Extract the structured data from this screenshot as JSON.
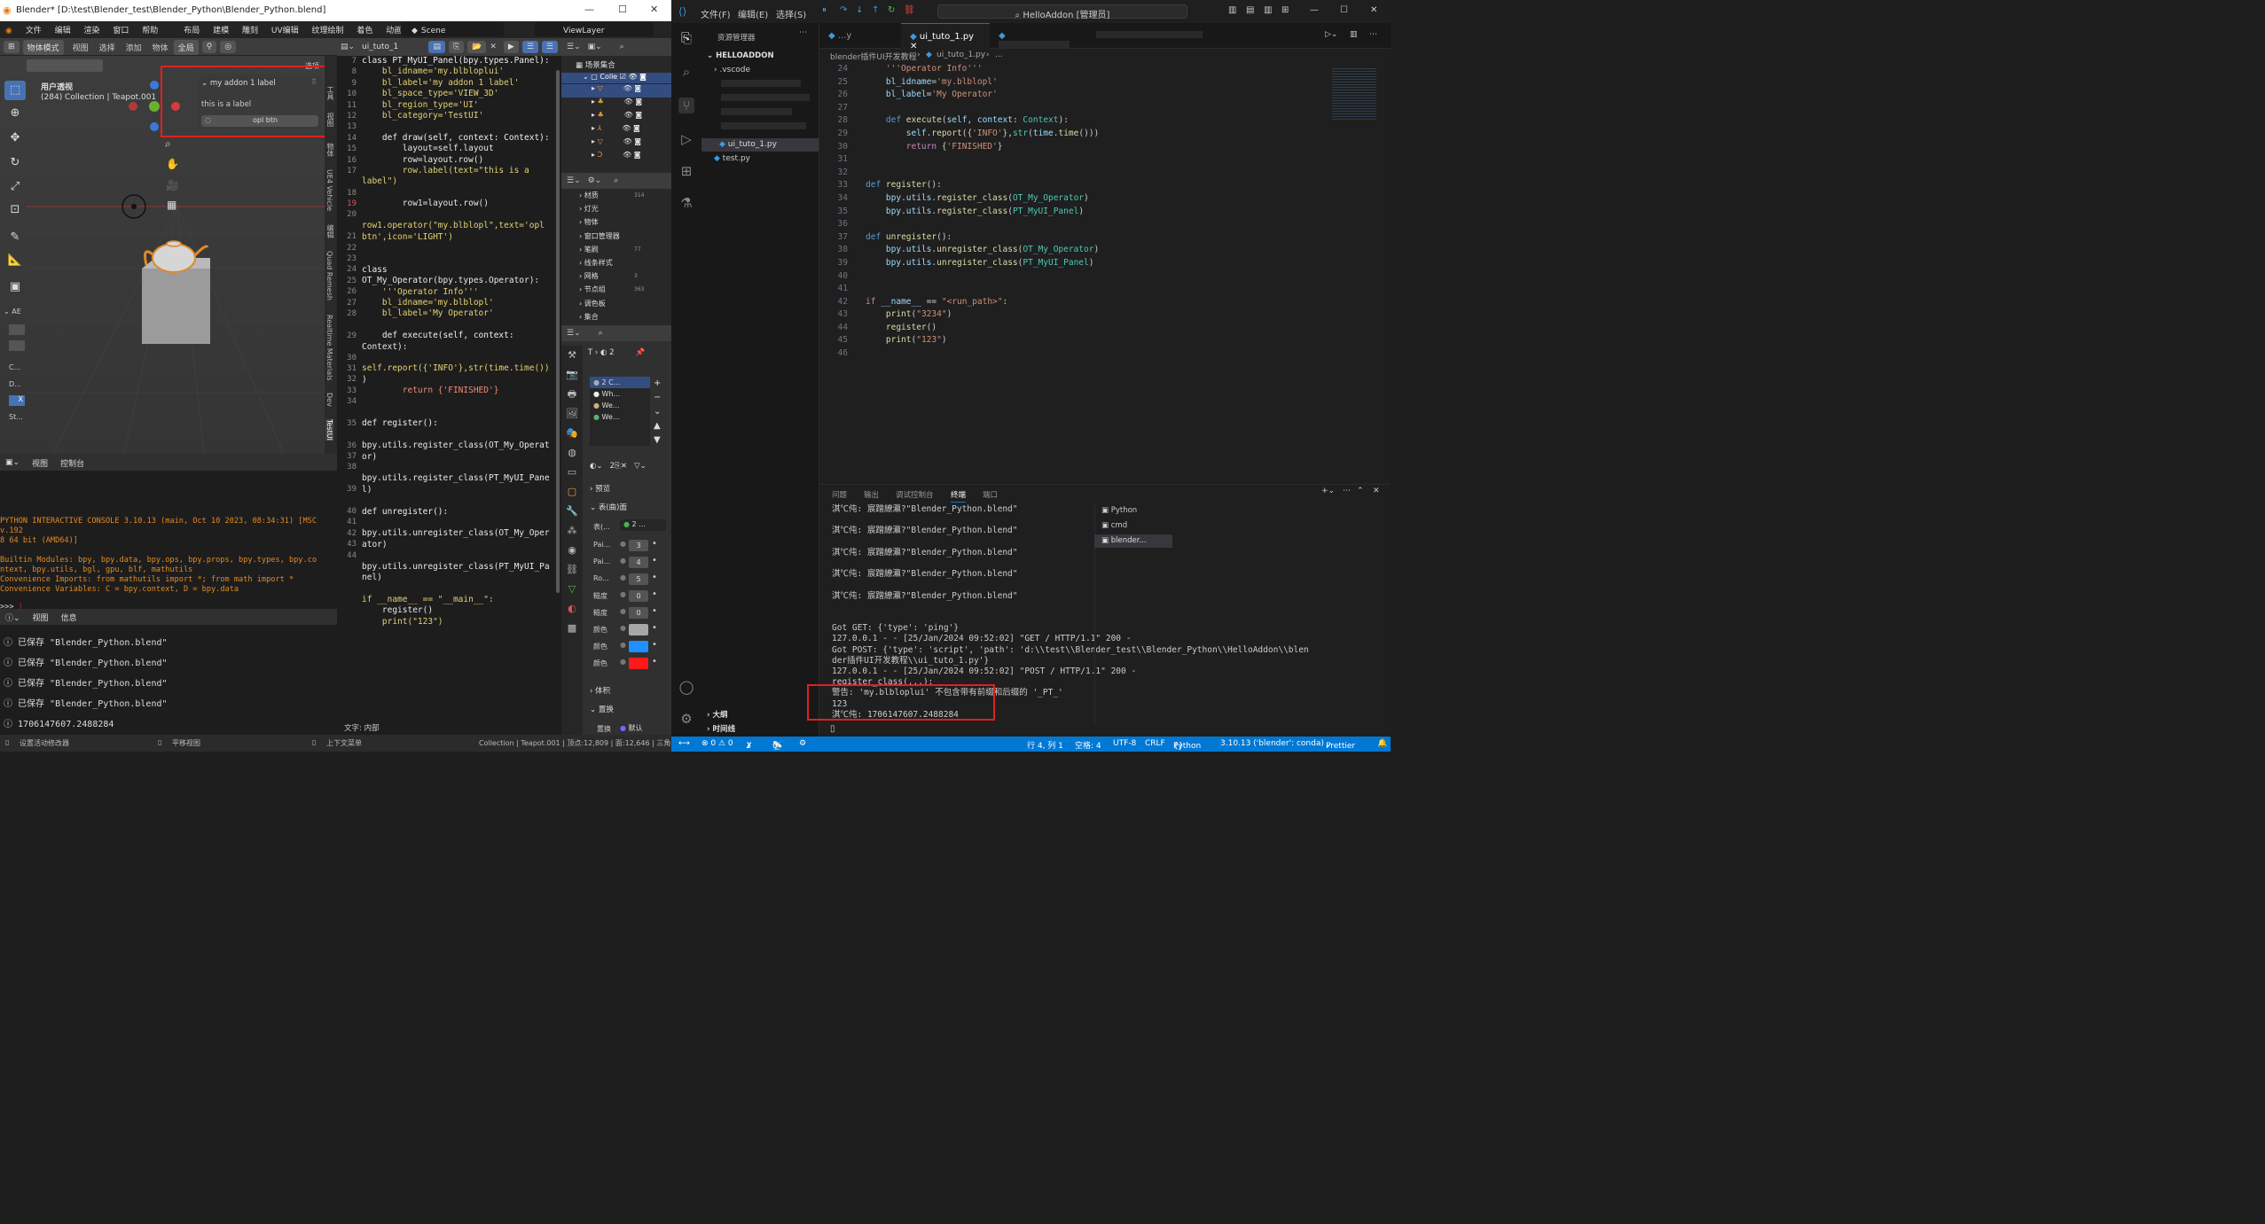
{
  "blender": {
    "title": "Blender* [D:\\test\\Blender_test\\Blender_Python\\Blender_Python.blend]",
    "menus": [
      "文件",
      "编辑",
      "渲染",
      "窗口",
      "帮助"
    ],
    "workspaces": [
      "布局",
      "建模",
      "雕刻",
      "UV编辑",
      "纹理绘制",
      "着色",
      "动画",
      "渲染"
    ],
    "scene": "Scene",
    "view_layer": "ViewLayer",
    "viewport_header": [
      "物体模式",
      "视图",
      "选择",
      "添加",
      "物体",
      "全局"
    ],
    "viewport_info": {
      "line1": "用户透视",
      "line2": "(284) Collection | Teapot.001"
    },
    "options_label": "选项",
    "panel": {
      "title": "my addon 1 label",
      "label": "this is a label",
      "button": "opl btn"
    },
    "n_tabs": [
      "工具",
      "视图",
      "物体",
      "UE4 Vehicle",
      "编辑",
      "Quad Remesh",
      "Realtime Materials",
      "Dev",
      "TestUI"
    ],
    "left_panel": {
      "section": "AE",
      "items": [
        "C...",
        "D...",
        "X",
        "St..."
      ]
    },
    "console": {
      "header": [
        "视图",
        "控制台"
      ],
      "lines": [
        "PYTHON INTERACTIVE CONSOLE 3.10.13 (main, Oct 10 2023, 08:34:31) [MSC v.192",
        "8 64 bit (AMD64)]",
        "",
        "Builtin Modules:      bpy, bpy.data, bpy.ops, bpy.props, bpy.types, bpy.co",
        "ntext, bpy.utils, bgl, gpu, blf, mathutils",
        "Convenience Imports:   from mathutils import *; from math import *",
        "Convenience Variables: C = bpy.context, D = bpy.data"
      ],
      "prompt": ">>> "
    },
    "info": {
      "header": [
        "视图",
        "信息"
      ],
      "lines": [
        "已保存 \"Blender_Python.blend\"",
        "已保存 \"Blender_Python.blend\"",
        "已保存 \"Blender_Python.blend\"",
        "已保存 \"Blender_Python.blend\"",
        "1706147607.2488284"
      ]
    },
    "text_editor": {
      "filename": "ui_tuto_1",
      "footer": "文字: 内部",
      "line_numbers": [
        "7",
        "8",
        "9",
        "10",
        "11",
        "12",
        "13",
        "14",
        "15",
        "16",
        "17",
        "",
        "18",
        "19",
        "20",
        "",
        "21",
        "22",
        "23",
        "24",
        "25",
        "26",
        "27",
        "28",
        "",
        "29",
        "",
        "30",
        "31",
        "32",
        "33",
        "34",
        "",
        "35",
        "",
        "36",
        "37",
        "38",
        "",
        "39",
        "",
        "40",
        "41",
        "42",
        "43",
        "44"
      ],
      "lines": [
        "class PT_MyUI_Panel(bpy.types.Panel):",
        "    bl_idname='my.blbloplui'",
        "    bl_label='my addon 1 label'",
        "    bl_space_type='VIEW_3D'",
        "    bl_region_type='UI'",
        "    bl_category='TestUI'",
        "",
        "    def draw(self, context: Context):",
        "        layout=self.layout",
        "        row=layout.row()",
        "        row.label(text=\"this is a",
        "label\")",
        "",
        "        row1=layout.row()",
        "",
        "row1.operator(\"my.blblopl\",text='opl",
        "btn',icon='LIGHT')",
        "",
        "",
        "class",
        "OT_My_Operator(bpy.types.Operator):",
        "    '''Operator Info'''",
        "    bl_idname='my.blblopl'",
        "    bl_label='My Operator'",
        "",
        "    def execute(self, context:",
        "Context):",
        "",
        "self.report({'INFO'},str(time.time())",
        ")",
        "        return {'FINISHED'}",
        "",
        "",
        "def register():",
        "",
        "bpy.utils.register_class(OT_My_Operat",
        "or)",
        "",
        "bpy.utils.register_class(PT_MyUI_Pane",
        "l)",
        "",
        "def unregister():",
        "",
        "bpy.utils.unregister_class(OT_My_Oper",
        "ator)",
        "",
        "bpy.utils.unregister_class(PT_MyUI_Pa",
        "nel)",
        "",
        "if __name__ == \"__main__\":",
        "    register()",
        "    print(\"123\")"
      ]
    },
    "outliner": {
      "title": "场景集合",
      "items": [
        "Colle",
        "",
        "",
        "",
        "",
        "",
        ""
      ]
    },
    "data_list": [
      "材质",
      "灯光",
      "物体",
      "窗口管理器",
      "笔刷",
      "线条样式",
      "网格",
      "节点组",
      "调色板",
      "集合"
    ],
    "data_counts": [
      "314",
      "",
      "",
      "",
      "77",
      "",
      "3",
      "363",
      "",
      ""
    ],
    "props": {
      "materials": [
        "2 C...",
        "Wh...",
        "We...",
        "We..."
      ],
      "sections": [
        "预览",
        "表(曲)面",
        "体积",
        "置换"
      ],
      "surface_first": "表(...",
      "surface_first_val": "2 ...",
      "rows": [
        {
          "label": "Pai...",
          "value": "3"
        },
        {
          "label": "Pai...",
          "value": "4"
        },
        {
          "label": "Ro...",
          "value": "5"
        },
        {
          "label": "糙度",
          "value": "0"
        },
        {
          "label": "糙度",
          "value": "0"
        },
        {
          "label": "颜色",
          "value": ""
        },
        {
          "label": "颜色",
          "value": ""
        },
        {
          "label": "颜色",
          "value": ""
        }
      ],
      "swatches": [
        "#a8a8a8",
        "#1e90ff",
        "#ff1a1a"
      ],
      "displace_label": "置换",
      "displace_value": "默认"
    },
    "status": {
      "left": "设置活动修改器",
      "mid": "平移视图",
      "mid2": "上下文菜单",
      "right": "Collection | Teapot.001 | 顶点:12,809 | 面:12,646 | 三角"
    }
  },
  "vscode": {
    "menus": [
      "文件(F)",
      "编辑(E)",
      "选择(S)"
    ],
    "search": "HelloAddon [管理员]",
    "explorer_title": "资源管理器",
    "project": "HELLOADDON",
    "tree": [
      ".vscode",
      "ui_tuto_1.py",
      "test.py"
    ],
    "outline": "大纲",
    "timeline": "时间线",
    "tabs": [
      "...y",
      "ui_tuto_1.py"
    ],
    "breadcrumb": [
      "blender插件UI开发教程",
      "ui_tuto_1.py",
      "..."
    ],
    "line_numbers": [
      "24",
      "25",
      "26",
      "27",
      "28",
      "29",
      "30",
      "31",
      "32",
      "33",
      "34",
      "35",
      "36",
      "37",
      "38",
      "39",
      "40",
      "41",
      "42",
      "43",
      "44",
      "45",
      "46"
    ],
    "panel_tabs": [
      "问题",
      "输出",
      "调试控制台",
      "终端",
      "端口"
    ],
    "terminals": [
      "Python",
      "cmd",
      "blender..."
    ],
    "terminal_lines": [
      "淇℃伅: 宸蹭繚瀛?\"Blender_Python.blend\"",
      "",
      "淇℃伅: 宸蹭繚瀛?\"Blender_Python.blend\"",
      "",
      "淇℃伅: 宸蹭繚瀛?\"Blender_Python.blend\"",
      "",
      "淇℃伅: 宸蹭繚瀛?\"Blender_Python.blend\"",
      "",
      "淇℃伅: 宸蹭繚瀛?\"Blender_Python.blend\"",
      "",
      "",
      "Got GET: {'type': 'ping'}",
      "127.0.0.1 - - [25/Jan/2024 09:52:02] \"GET / HTTP/1.1\" 200 -",
      "Got POST: {'type': 'script', 'path': 'd:\\\\test\\\\Blender_test\\\\Blender_Python\\\\HelloAddon\\\\blen",
      "der插件UI开发教程\\\\ui_tuto_1.py'}",
      "127.0.0.1 - - [25/Jan/2024 09:52:02] \"POST / HTTP/1.1\" 200 -",
      "register_class(...):",
      "警告: 'my.blbloplui' 不包含带有前缀和后缀的 '_PT_'",
      "123",
      "淇℃伅: 1706147607.2488284"
    ],
    "status": {
      "errors": "⊗ 0 ⚠ 0",
      "ports": "1",
      "radio": "0",
      "position": "行 4, 列 1",
      "spaces": "空格: 4",
      "encoding": "UTF-8",
      "eol": "CRLF",
      "lang": "Python",
      "interp": "3.10.13 ('blender': conda)",
      "prettier": "Prettier"
    }
  }
}
